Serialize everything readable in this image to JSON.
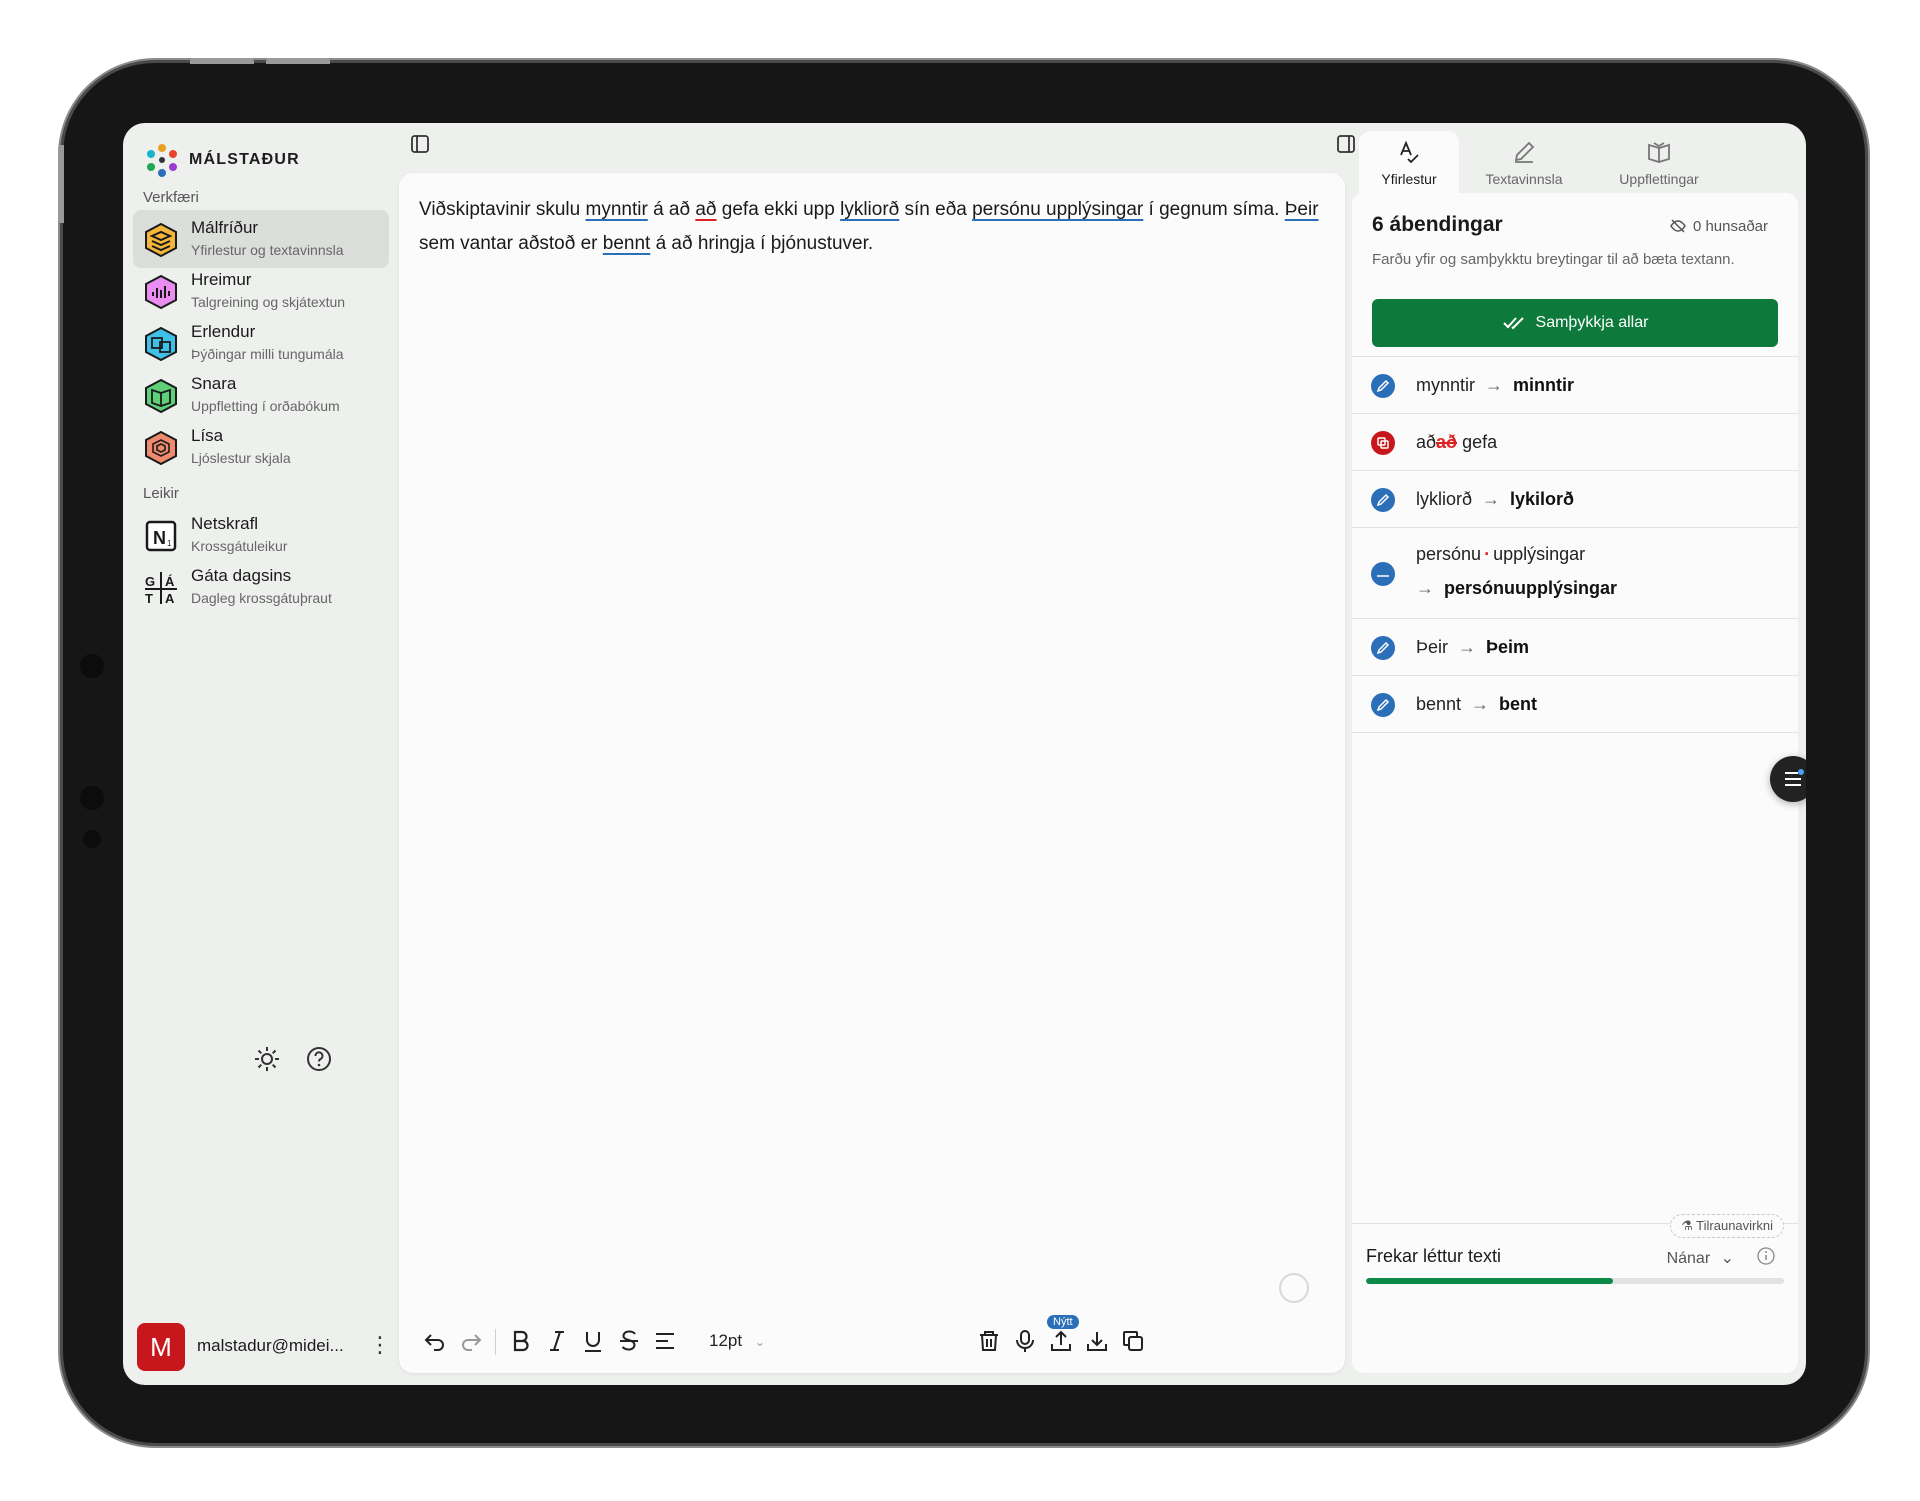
{
  "app": {
    "name": "MÁLSTAÐUR",
    "colors": {
      "accent_green": "#0d7a3c",
      "accent_blue": "#2a6fb8",
      "error_red": "#c8171c"
    }
  },
  "sidebar": {
    "tools_label": "Verkfæri",
    "tools": [
      {
        "title": "Málfríður",
        "subtitle": "Yfirlestur og textavinnsla",
        "icon": "malfridur-icon",
        "active": true
      },
      {
        "title": "Hreimur",
        "subtitle": "Talgreining og skjátextun",
        "icon": "hreimur-icon"
      },
      {
        "title": "Erlendur",
        "subtitle": "Þýðingar milli tungumála",
        "icon": "erlendur-icon"
      },
      {
        "title": "Snara",
        "subtitle": "Uppfletting í orðabókum",
        "icon": "snara-icon"
      },
      {
        "title": "Lísa",
        "subtitle": "Ljóslestur skjala",
        "icon": "lisa-icon"
      }
    ],
    "games_label": "Leikir",
    "games": [
      {
        "title": "Netskrafl",
        "subtitle": "Krossgátuleikur",
        "icon": "netskrafl-icon"
      },
      {
        "title": "Gáta dagsins",
        "subtitle": "Dagleg krossgátuþraut",
        "icon": "gata-dagsins-icon"
      }
    ],
    "user": {
      "initial": "M",
      "email": "malstadur@midei..."
    }
  },
  "editor": {
    "paragraph": [
      {
        "t": "Viðskiptavinir skulu "
      },
      {
        "t": "mynntir",
        "u": "blue"
      },
      {
        "t": " á að "
      },
      {
        "t": "að",
        "u": "red"
      },
      {
        "t": " gefa ekki upp "
      },
      {
        "t": "lykliorð",
        "u": "blue"
      },
      {
        "t": " sín eða "
      },
      {
        "t": "persónu upplýsingar",
        "u": "blue"
      },
      {
        "t": " í gegnum síma. "
      },
      {
        "t": "Þeir",
        "u": "blue"
      },
      {
        "t": " sem vantar aðstoð er "
      },
      {
        "t": "bennt",
        "u": "blue"
      },
      {
        "t": " á að hringja í þjónustuver."
      }
    ],
    "font_size": "12pt",
    "new_badge": "Nýtt"
  },
  "right_panel": {
    "tabs": [
      {
        "label": "Yfirlestur",
        "icon": "spellcheck-icon",
        "active": true
      },
      {
        "label": "Textavinnsla",
        "icon": "pencil-icon"
      },
      {
        "label": "Uppflettingar",
        "icon": "open-book-icon"
      }
    ],
    "suggestions_title": "6 ábendingar",
    "rejected": "0 hunsaðar",
    "description": "Farðu yfir og samþykktu breytingar til að bæta textann.",
    "accept_all": "Samþykkja allar",
    "suggestions": [
      {
        "type": "replace",
        "from": "mynntir",
        "to": "minntir"
      },
      {
        "type": "delete",
        "before": "að",
        "removed": "að",
        "after": "gefa"
      },
      {
        "type": "replace",
        "from": "lykliorð",
        "to": "lykilorð"
      },
      {
        "type": "join",
        "part1": "persónu",
        "part2": "upplýsingar",
        "to": "persónuupplýsingar"
      },
      {
        "type": "replace",
        "from": "Þeir",
        "to": "Þeim"
      },
      {
        "type": "replace",
        "from": "bennt",
        "to": "bent"
      }
    ],
    "readability": {
      "beta": "Tilraunavirkni",
      "label": "Frekar léttur texti",
      "more": "Nánar",
      "level": 0.59
    }
  }
}
